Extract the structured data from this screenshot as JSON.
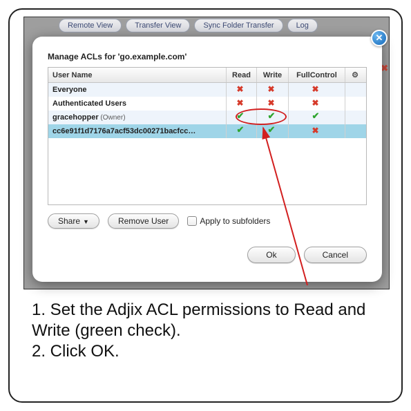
{
  "background_tabs": [
    "Remote View",
    "Transfer View",
    "Sync Folder Transfer",
    "Log"
  ],
  "dialog": {
    "title": "Manage ACLs for 'go.example.com'",
    "columns": {
      "user": "User Name",
      "read": "Read",
      "write": "Write",
      "full": "FullControl"
    },
    "rows": [
      {
        "name": "Everyone",
        "owner": false,
        "read": false,
        "write": false,
        "full": false,
        "selected": false
      },
      {
        "name": "Authenticated Users",
        "owner": false,
        "read": false,
        "write": false,
        "full": false,
        "selected": false
      },
      {
        "name": "gracehopper",
        "owner": true,
        "read": true,
        "write": true,
        "full": true,
        "selected": false
      },
      {
        "name": "cc6e91f1d7176a7acf53dc00271bacfcc…",
        "owner": false,
        "read": true,
        "write": true,
        "full": false,
        "selected": true
      }
    ],
    "owner_label": "(Owner)",
    "share_label": "Share",
    "remove_label": "Remove User",
    "apply_label": "Apply to subfolders",
    "ok_label": "Ok",
    "cancel_label": "Cancel"
  },
  "instructions": {
    "line1": "1. Set the Adjix ACL permissions to Read and Write (green check).",
    "line2": "2. Click OK."
  }
}
